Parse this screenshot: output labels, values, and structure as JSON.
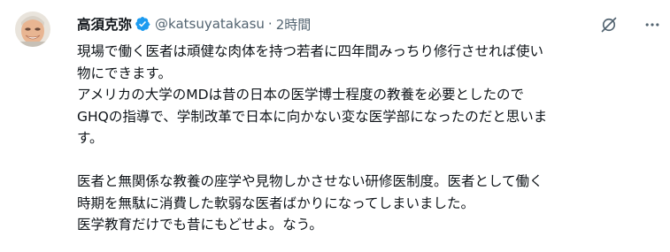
{
  "post": {
    "author": {
      "display_name": "高須克弥",
      "handle": "@katsuyatakasu",
      "verified": true,
      "avatar_icon": "profile-photo"
    },
    "separator": "·",
    "timestamp": "2時間",
    "actions": {
      "grok_icon": "grok-icon",
      "more_icon": "more-horizontal-icon"
    },
    "text_lines": [
      "現場で働く医者は頑健な肉体を持つ若者に四年間みっちり修行させれば使い",
      "物にできます。",
      "アメリカの大学のMDは昔の日本の医学博士程度の教養を必要としたので",
      "GHQの指導で、学制改革で日本に向かない変な医学部になったのだと思いま",
      "す。",
      "",
      "医者と無関係な教養の座学や見物しかさせない研修医制度。医者として働く",
      "時期を無駄に消費した軟弱な医者ばかりになってしまいました。",
      "医学教育だけでも昔にもどせよ。なう。"
    ],
    "colors": {
      "text": "#0f1419",
      "secondary": "#536471",
      "verified_badge": "#1d9bf0"
    }
  }
}
